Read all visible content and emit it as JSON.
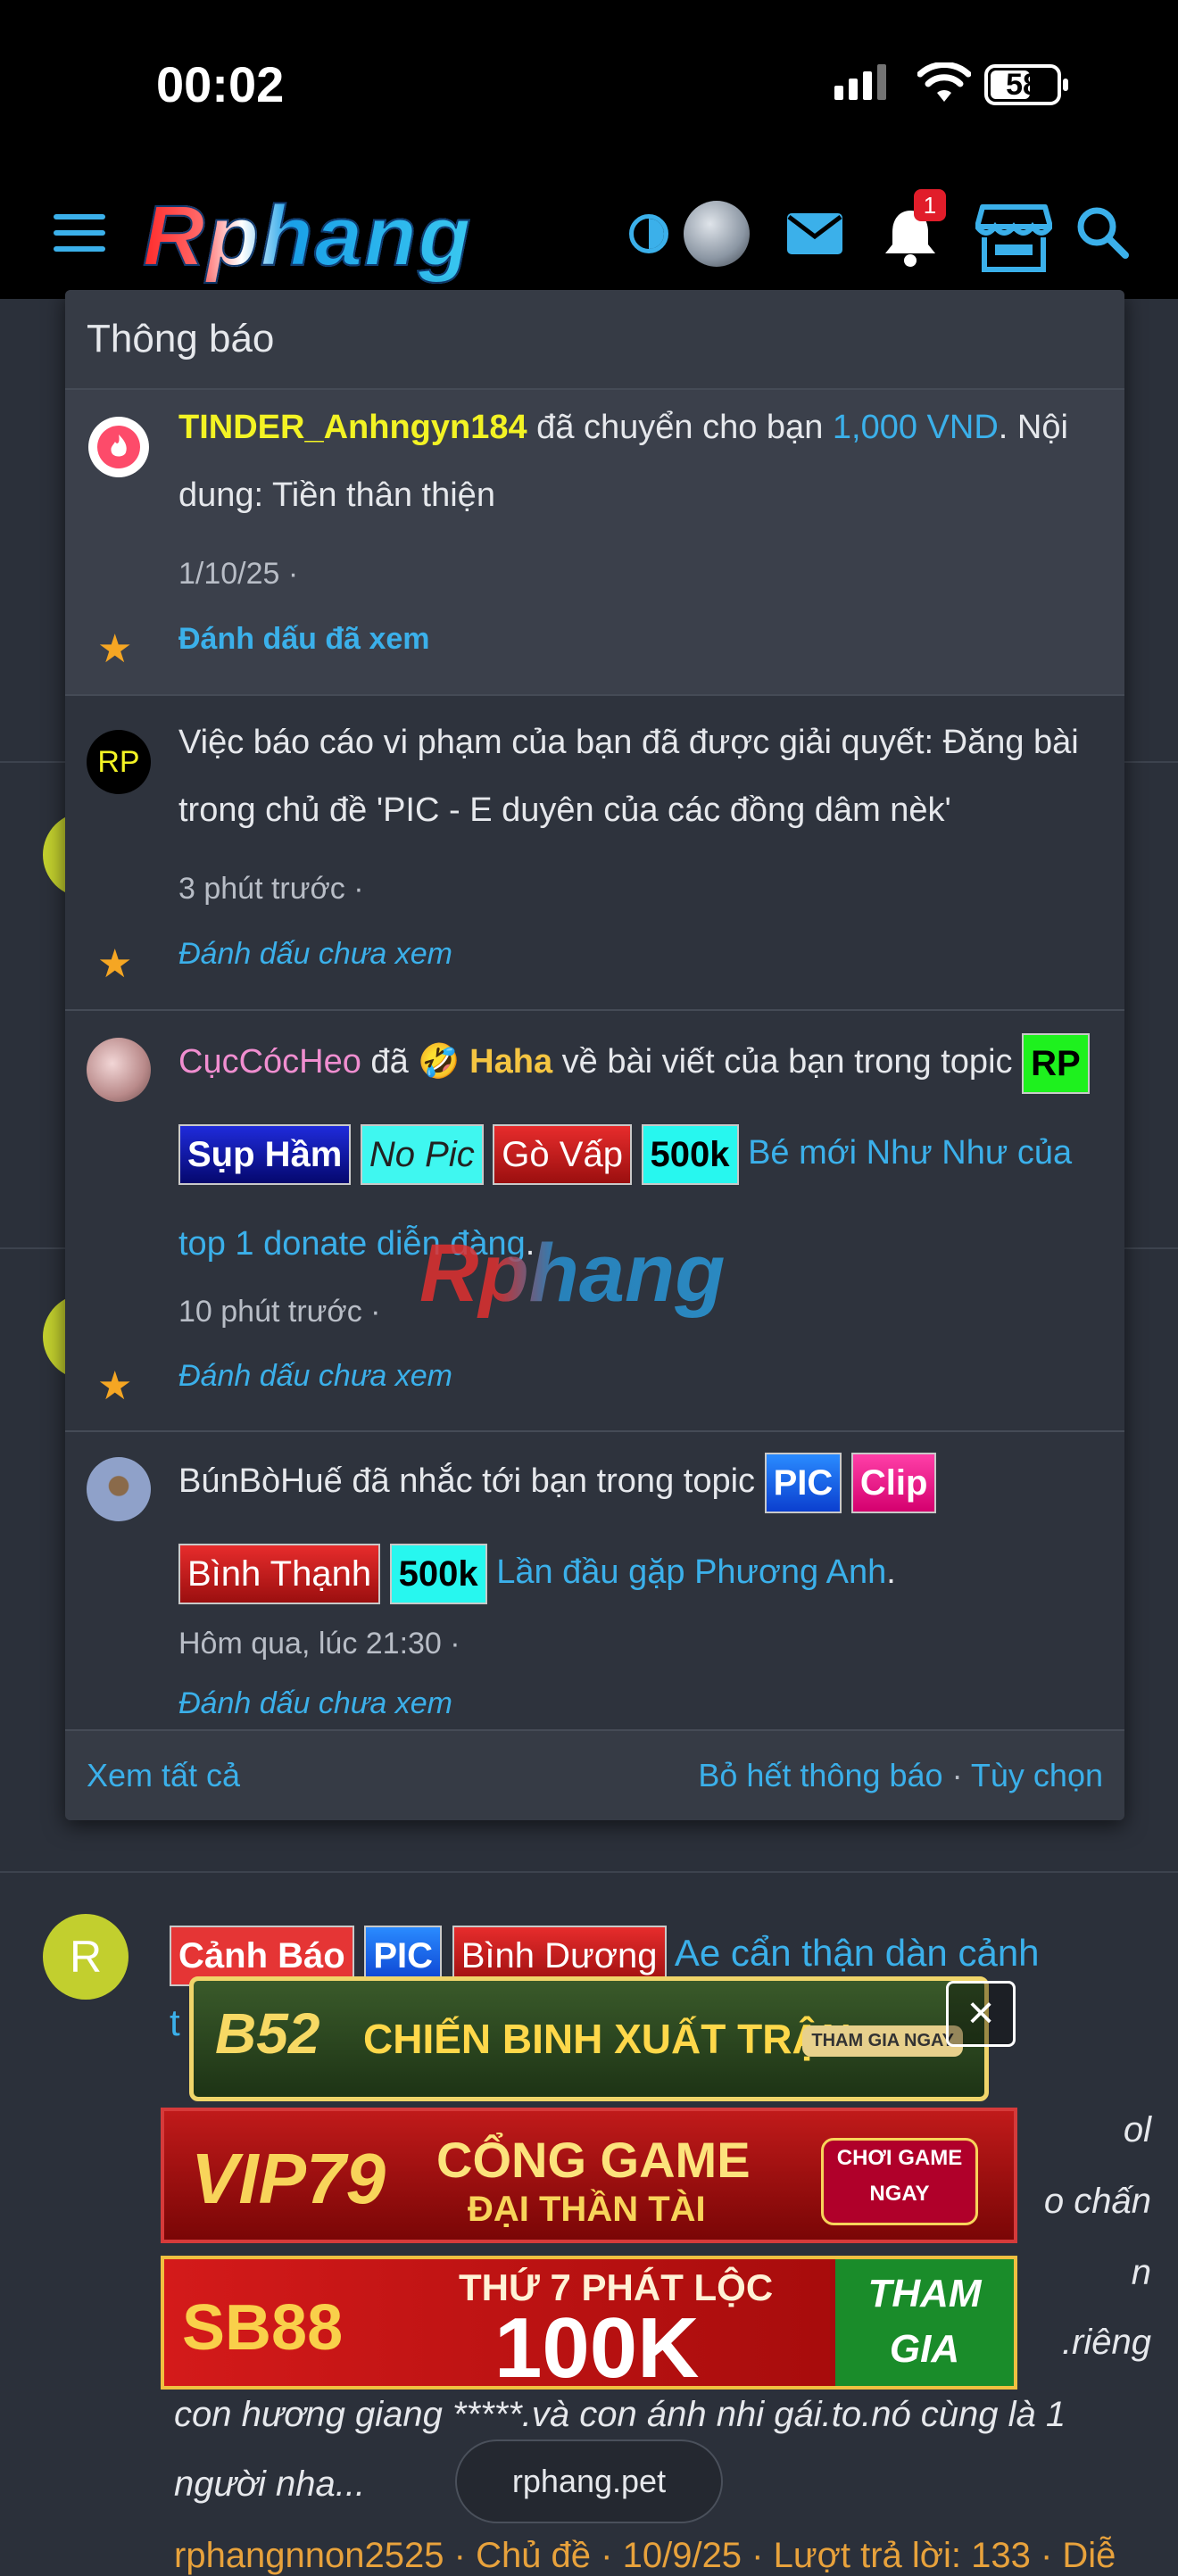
{
  "status_bar": {
    "time": "00:02",
    "battery": "58"
  },
  "header": {
    "logo": "Rphang",
    "notification_badge": "1"
  },
  "dropdown": {
    "title": "Thông báo",
    "footer": {
      "view_all": "Xem tất cả",
      "dismiss_all": "Bỏ hết thông báo",
      "separator": " · ",
      "options": "Tùy chọn"
    },
    "watermark": "Rphang",
    "notifications": [
      {
        "user": "TINDER_Anhngyn184",
        "text1": " đã chuyển cho bạn ",
        "amount": "1,000 VND",
        "text2": ". Nội dung: Tiền thân thiện",
        "time": "1/10/25 ·",
        "mark": "Đánh dấu đã xem"
      },
      {
        "avatar_text": "RP",
        "text": "Việc báo cáo vi phạm của bạn đã được giải quyết: Đăng bài trong chủ đề 'PIC - E duyên của các đồng dâm nèk'",
        "time": "3 phút trước ·",
        "mark": "Đánh dấu chưa xem"
      },
      {
        "user": "CụcCócHeo",
        "verb": " đã ",
        "reaction_emoji": "🤣",
        "reaction": "Haha",
        "text": " về bài viết của bạn trong topic ",
        "tags": [
          "RP",
          "Sụp Hầm",
          "No Pic",
          "Gò Vấp",
          "500k"
        ],
        "topic": "Bé mới Như Như của top 1 donate diễn đàng",
        "end": ".",
        "time": "10 phút trước ·",
        "mark": "Đánh dấu chưa xem"
      },
      {
        "user": "BúnBòHuế",
        "text": " đã nhắc tới bạn trong topic ",
        "tags": [
          "PIC",
          "Clip",
          "Bình Thạnh",
          "500k"
        ],
        "topic": "Lần đầu gặp Phương Anh",
        "end": ".",
        "time": "Hôm qua, lúc 21:30 ·",
        "mark": "Đánh dấu chưa xem"
      }
    ]
  },
  "background_post": {
    "avatar_letter": "R",
    "tags": [
      "Cảnh Báo",
      "PIC",
      "Bình Dương"
    ],
    "title": "Ae cẩn thận dàn cảnh",
    "title_cont": "t",
    "fragment_right_1": "ol",
    "fragment_right_2": "o chấn",
    "fragment_right_3": "n",
    "fragment_right_4": ".riêng",
    "line_1": "con hương giang *****.và con ánh nhi gái.to.nó cùng là 1",
    "line_2": "người nha...",
    "footer": "rphangnnon2525 · Chủ đề · 10/9/25 · Lượt trả lời: 133 · Diễ"
  },
  "ads": {
    "b52": {
      "brand": "B52",
      "text": "CHIẾN BINH XUẤT TRẬN",
      "cta": "THAM GIA NGAY"
    },
    "vip79": {
      "brand": "VIP79",
      "line1": "CỔNG GAME",
      "line2": "ĐẠI THẦN TÀI",
      "cta": "CHƠI GAME NGAY"
    },
    "sb88": {
      "brand": "SB88",
      "line1": "THỨ 7 PHÁT LỘC",
      "line2": "100K",
      "cta": "THAM GIA NGAY"
    },
    "close": "×"
  },
  "domain": "rphang.pet",
  "colors": {
    "accent": "#3bb0ea",
    "username_yellow": "#f3f324",
    "username_pink": "#f08ed0",
    "star": "#f5a623",
    "badge": "#e11d2a"
  }
}
